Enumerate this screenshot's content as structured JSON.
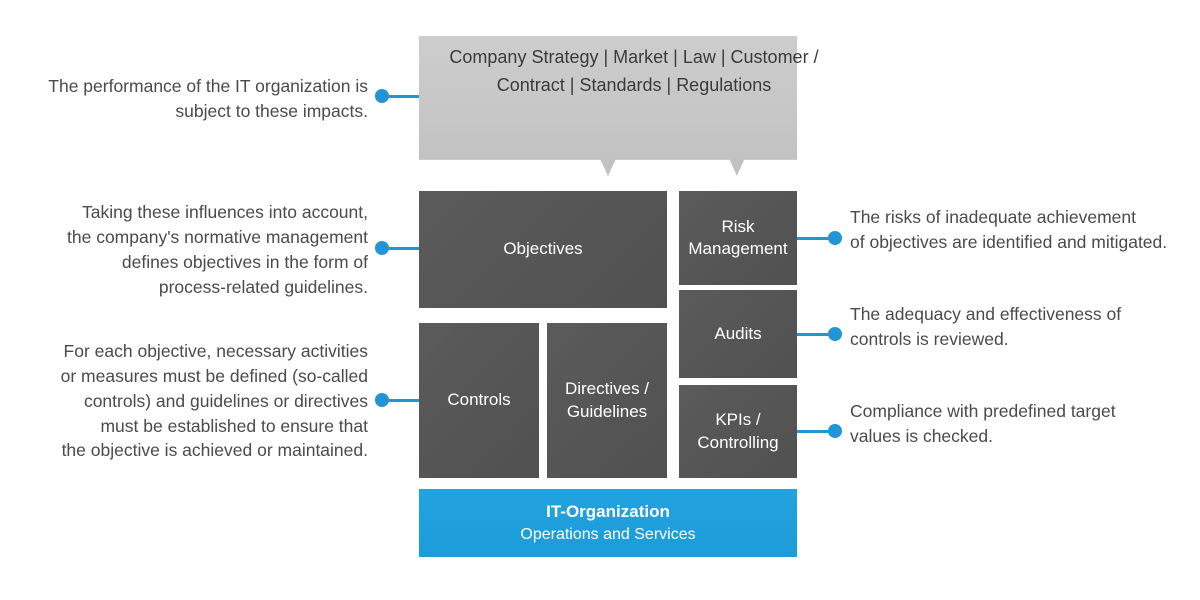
{
  "diagram": {
    "banner": {
      "text": "Company Strategy | Market | Law | Customer /\nContract | Standards | Regulations",
      "color": "#c8c8c8"
    },
    "boxes": {
      "objectives": {
        "label": "Objectives",
        "color": "#575757"
      },
      "controls": {
        "label": "Controls",
        "color": "#575757"
      },
      "directives": {
        "label": "Directives /\nGuidelines",
        "color": "#575757"
      },
      "risk_management": {
        "label": "Risk\nManagement",
        "color": "#575757"
      },
      "audits": {
        "label": "Audits",
        "color": "#575757"
      },
      "kpis": {
        "label": "KPIs /\nControlling",
        "color": "#575757"
      },
      "it_organization": {
        "title": "IT-Organization",
        "subtitle": "Operations and Services",
        "color": "#1c9fdc"
      }
    },
    "callouts": {
      "left": [
        {
          "text": "The performance of the IT organization is\nsubject to these impacts."
        },
        {
          "text": "Taking these influences into account,\nthe company's normative management\ndefines objectives in the form of\nprocess-related guidelines."
        },
        {
          "text": "For each objective, necessary activities\nor measures must be defined (so-called\ncontrols) and guidelines or directives\nmust be established to ensure that\nthe objective is achieved or maintained."
        }
      ],
      "right": [
        {
          "text": "The risks of inadequate achievement\nof objectives are identified and mitigated."
        },
        {
          "text": "The adequacy and effectiveness of\ncontrols is reviewed."
        },
        {
          "text": "Compliance with predefined target\nvalues is checked."
        }
      ]
    },
    "accent_color": "#2196d6",
    "text_color": "#4a4a4a"
  }
}
